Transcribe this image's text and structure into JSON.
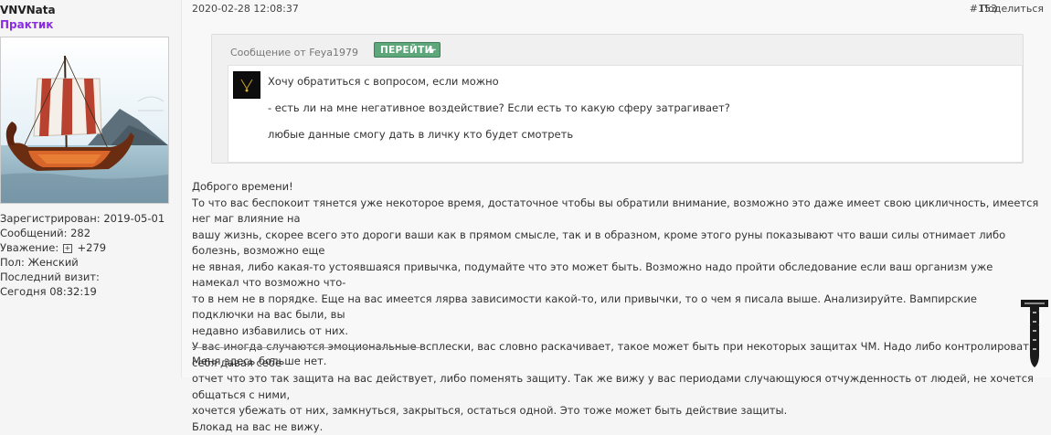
{
  "user": {
    "username": "VNVNata",
    "rank": "Практик",
    "registered": "Зарегистрирован: 2019-05-01",
    "posts": "Сообщений: 282",
    "reputation_label": "Уважение:",
    "reputation_value": "+279",
    "gender": "Пол: Женский",
    "last_visit_label": "Последний визит:",
    "last_visit_value": "Сегодня 08:32:19"
  },
  "post": {
    "date": "2020-02-28 12:08:37",
    "number": "#153",
    "share": "Поделиться"
  },
  "quote": {
    "header": "Сообщение от Feya1979",
    "goto_label": "ПЕРЕЙТИ",
    "lines": [
      "Хочу обратиться с вопросом, если можно",
      "- есть ли на мне негативное воздействие? Если есть то какую сферу затрагивает?",
      "любые данные смогу дать в личку кто будет смотреть"
    ]
  },
  "body": {
    "lines": [
      "Доброго времени!",
      "То что вас беспокоит тянется уже некоторое время, достаточное чтобы вы обратили внимание, возможно это даже имеет свою цикличность, имеется нег маг влияние на",
      "вашу жизнь, скорее всего это дороги ваши как в прямом смысле, так и в образном, кроме этого руны показывают что ваши силы отнимает либо болезнь, возможно еще",
      "не явная, либо какая-то устоявшаяся привычка, подумайте что это может быть. Возможно надо пройти обследование если ваш организм уже намекал что возможно что-",
      "то в нем не в порядке. Еще на вас имеется лярва зависимости какой-то, или привычки, то о чем я писала выше. Анализируйте. Вампирские подключки на вас были, вы",
      "недавно избавились от них.",
      "У вас иногда случаются эмоциональные всплески, вас словно раскачивает, такое может быть при некоторых защитах ЧМ. Надо либо контролировать себя давая себе",
      "отчет что это так защита на вас действует, либо поменять защиту. Так же вижу у вас периодами случающуюся отчужденность от людей, не хочется общаться с ними,",
      "хочется убежать от них, замкнуться, закрыться, остаться одной. Это тоже может быть действие защиты.",
      "Блокад на вас не вижу."
    ]
  },
  "signature": "Меня здесь больше нет."
}
